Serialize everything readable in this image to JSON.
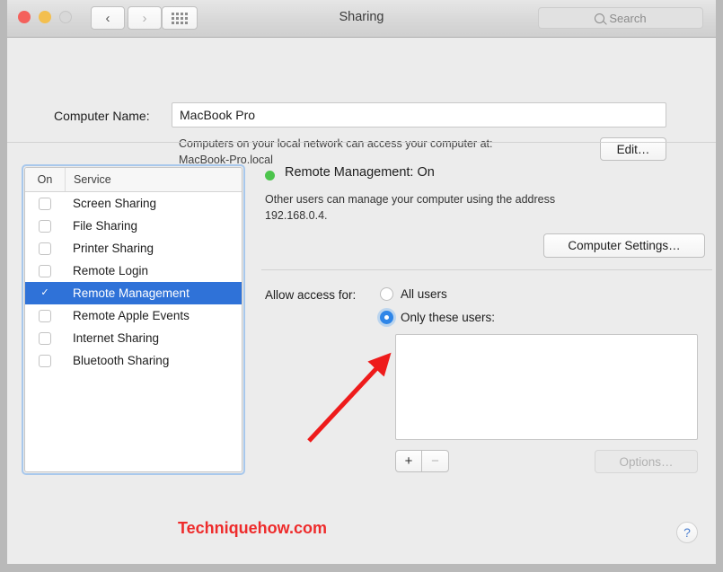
{
  "window": {
    "title": "Sharing",
    "traffic_lights": [
      "close",
      "minimize",
      "zoom"
    ],
    "nav_back_glyph": "‹",
    "nav_forward_glyph": "›",
    "grid_icon": "show-all-grid-icon"
  },
  "search": {
    "placeholder": "Search",
    "icon": "search-icon"
  },
  "computer_name": {
    "label": "Computer Name:",
    "value": "MacBook Pro",
    "help_line1": "Computers on your local network can access your computer at:",
    "help_line2": "MacBook-Pro.local",
    "edit_button": "Edit…"
  },
  "service_list": {
    "columns": [
      "On",
      "Service"
    ],
    "rows": [
      {
        "name": "Screen Sharing",
        "checked": false,
        "selected": false
      },
      {
        "name": "File Sharing",
        "checked": false,
        "selected": false
      },
      {
        "name": "Printer Sharing",
        "checked": false,
        "selected": false
      },
      {
        "name": "Remote Login",
        "checked": false,
        "selected": false
      },
      {
        "name": "Remote Management",
        "checked": true,
        "selected": true
      },
      {
        "name": "Remote Apple Events",
        "checked": false,
        "selected": false
      },
      {
        "name": "Internet Sharing",
        "checked": false,
        "selected": false
      },
      {
        "name": "Bluetooth Sharing",
        "checked": false,
        "selected": false
      }
    ],
    "check_glyph": "✓"
  },
  "detail": {
    "status_title": "Remote Management: On",
    "status_dot_color": "#4cc44c",
    "description_line1": "Other users can manage your computer using the address",
    "description_line2": "192.168.0.4.",
    "computer_settings_button": "Computer Settings…",
    "allow_access_label": "Allow access for:",
    "radio_all_users": "All users",
    "radio_only_these_users": "Only these users:",
    "selected_radio": "only_these_users",
    "users": [],
    "add_button": "+",
    "remove_button": "−",
    "options_button": "Options…"
  },
  "annotation": {
    "arrow_color": "#ee1b1b",
    "watermark": "Techniquehow.com",
    "watermark_color": "#ee2b2b"
  },
  "help": {
    "glyph": "?",
    "label": "help-button"
  }
}
